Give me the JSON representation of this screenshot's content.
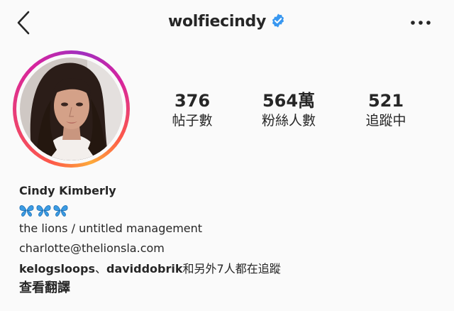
{
  "header": {
    "username": "wolfiecindy",
    "back_icon": "chevron-left-icon",
    "verified_icon": "verified-badge-icon",
    "more_icon": "more-horizontal-icon"
  },
  "profile": {
    "avatar_ring_colors": [
      "#fd5949",
      "#d6249f",
      "#a02fbf",
      "#fdaa3a"
    ]
  },
  "stats": [
    {
      "value": "376",
      "label": "帖子數"
    },
    {
      "value": "564萬",
      "label": "粉絲人數"
    },
    {
      "value": "521",
      "label": "追蹤中"
    }
  ],
  "bio": {
    "name": "Cindy Kimberly",
    "emoji_icons": [
      "butterfly-icon",
      "butterfly-icon",
      "butterfly-icon"
    ],
    "line1": "the lions / untitled management",
    "line2": "charlotte@thelionsla.com",
    "followed_by_user1": "kelogsloops",
    "followed_by_separator": "、",
    "followed_by_user2": "daviddobrik",
    "followed_by_suffix": "和另外7人都在追蹤",
    "translate": "查看翻譯"
  },
  "colors": {
    "text": "#262626",
    "background": "#fafafa",
    "verified_blue": "#3897f0",
    "butterfly_blue": "#3b9be3"
  }
}
